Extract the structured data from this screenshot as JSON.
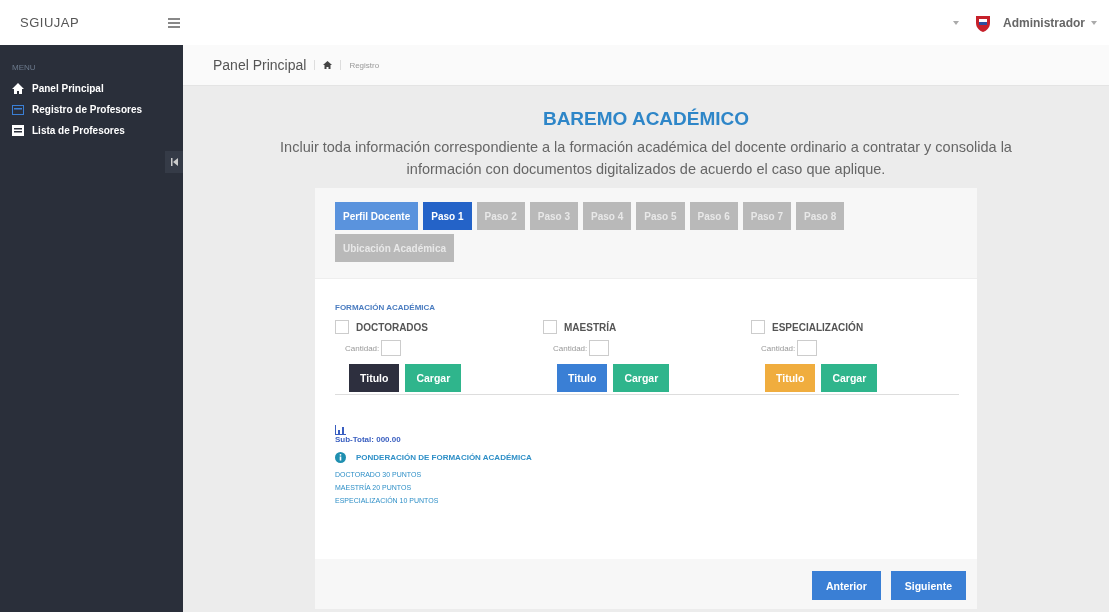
{
  "header": {
    "brand": "SGIUJAP",
    "user": "Administrador"
  },
  "sidebar": {
    "heading": "MENU",
    "items": [
      {
        "label": "Panel Principal",
        "kind": "home",
        "selected": false
      },
      {
        "label": "Registro de Profesores",
        "kind": "register",
        "selected": false
      },
      {
        "label": "Lista de Profesores",
        "kind": "list",
        "selected": false
      }
    ]
  },
  "breadcrumb": {
    "title": "Panel Principal",
    "crumb": "Registro"
  },
  "page": {
    "title": "BAREMO ACADÉMICO",
    "description": "Incluir toda información correspondiente a la formación académica del docente ordinario a contratar y consolida la información con documentos digitalizados de acuerdo el caso que aplique."
  },
  "tabs": [
    {
      "label": "Perfil Docente",
      "selected": false,
      "disabled": false
    },
    {
      "label": "Paso 1",
      "selected": true,
      "disabled": false
    },
    {
      "label": "Paso 2",
      "selected": false,
      "disabled": true
    },
    {
      "label": "Paso 3",
      "selected": false,
      "disabled": true
    },
    {
      "label": "Paso 4",
      "selected": false,
      "disabled": true
    },
    {
      "label": "Paso 5",
      "selected": false,
      "disabled": true
    },
    {
      "label": "Paso 6",
      "selected": false,
      "disabled": true
    },
    {
      "label": "Paso 7",
      "selected": false,
      "disabled": true
    },
    {
      "label": "Paso 8",
      "selected": false,
      "disabled": true
    },
    {
      "label": "Ubicación Académica",
      "selected": false,
      "disabled": true
    }
  ],
  "section": {
    "title": "FORMACIÓN ACADÉMICA",
    "groups": [
      {
        "label": "DOCTORADOS",
        "checked": false,
        "quantity_label": "Cantidad:",
        "title_button": "Titulo",
        "color": "#2d2f3e",
        "upload_button": "Cargar"
      },
      {
        "label": "MAESTRÍA",
        "checked": false,
        "quantity_label": "Cantidad:",
        "title_button": "Titulo",
        "color": "#3a7fd5",
        "upload_button": "Cargar"
      },
      {
        "label": "ESPECIALIZACIÓN",
        "checked": false,
        "quantity_label": "Cantidad:",
        "title_button": "Titulo",
        "color": "#f0ad3e",
        "upload_button": "Cargar"
      }
    ]
  },
  "summary": {
    "subtotal": "Sub-Total: 000.00",
    "info_title": "PONDERACIÓN DE FORMACIÓN ACADÉMICA",
    "lines": [
      "DOCTORADO 30 PUNTOS",
      "MAESTRÍA 20 PUNTOS",
      "ESPECIALIZACIÓN 10 PUNTOS"
    ]
  },
  "footer_buttons": [
    "Anterior",
    "Siguiente"
  ]
}
